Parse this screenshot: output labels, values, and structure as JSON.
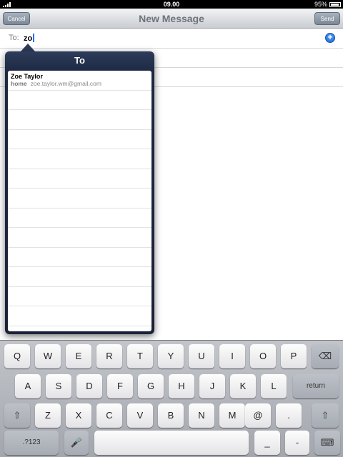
{
  "status_bar": {
    "time": "09.00",
    "battery": "95%"
  },
  "nav": {
    "cancel_label": "Cancel",
    "title": "New Message",
    "send_label": "Send"
  },
  "compose": {
    "to_label": "To:",
    "to_value": "zo"
  },
  "popover": {
    "title": "To",
    "contacts": [
      {
        "name": "Zoe Taylor",
        "type": "home",
        "email": "zoe.taylor.wm@gmail.com"
      }
    ]
  },
  "keyboard": {
    "row1": [
      "Q",
      "W",
      "E",
      "R",
      "T",
      "Y",
      "U",
      "I",
      "O",
      "P"
    ],
    "row2": [
      "A",
      "S",
      "D",
      "F",
      "G",
      "H",
      "J",
      "K",
      "L"
    ],
    "row2_return": "return",
    "row3": [
      "Z",
      "X",
      "C",
      "V",
      "B",
      "N",
      "M",
      "@",
      "."
    ],
    "numbers_label": ".?123",
    "underscore": "_",
    "dash": "-",
    "shift_glyph": "⇧",
    "delete_glyph": "⌫",
    "mic_glyph": "🎤",
    "hide_glyph": "⌨"
  },
  "icons": [
    "signal-icon",
    "battery-icon",
    "add-contact-icon",
    "shift-icon",
    "delete-icon",
    "microphone-icon",
    "hide-keyboard-icon"
  ]
}
